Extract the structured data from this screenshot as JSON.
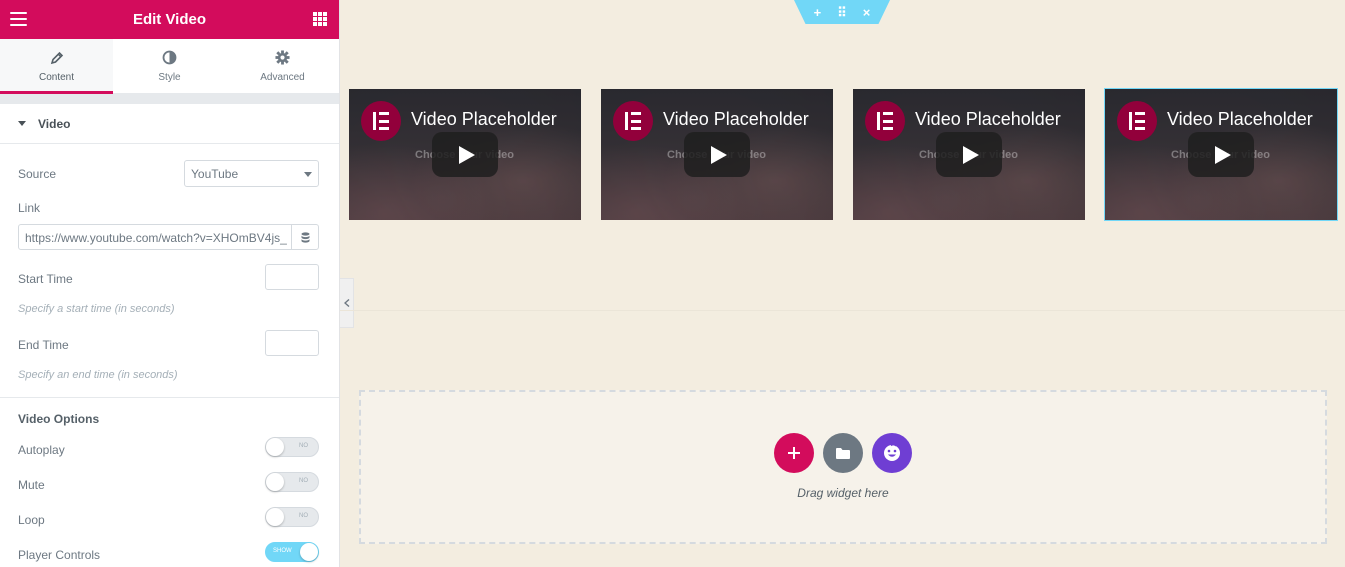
{
  "panel": {
    "title": "Edit Video",
    "tabs": [
      {
        "label": "Content",
        "icon": "pencil-icon",
        "active": true
      },
      {
        "label": "Style",
        "icon": "contrast-icon",
        "active": false
      },
      {
        "label": "Advanced",
        "icon": "gear-icon",
        "active": false
      }
    ],
    "section_title": "Video",
    "source": {
      "label": "Source",
      "value": "YouTube"
    },
    "link": {
      "label": "Link",
      "value": "https://www.youtube.com/watch?v=XHOmBV4js_"
    },
    "start_time": {
      "label": "Start Time",
      "hint": "Specify a start time (in seconds)"
    },
    "end_time": {
      "label": "End Time",
      "hint": "Specify an end time (in seconds)"
    },
    "video_options": {
      "title": "Video Options",
      "autoplay": {
        "label": "Autoplay",
        "state": "NO"
      },
      "mute": {
        "label": "Mute",
        "state": "NO"
      },
      "loop": {
        "label": "Loop",
        "state": "NO"
      },
      "player_controls": {
        "label": "Player Controls",
        "state": "SHOW"
      }
    }
  },
  "section_handle": {
    "add": "+",
    "drag": "⠿",
    "close": "×"
  },
  "videos": [
    {
      "title": "Video Placeholder",
      "overlay": "Choose your video"
    },
    {
      "title": "Video Placeholder",
      "overlay": "Choose your video"
    },
    {
      "title": "Video Placeholder",
      "overlay": "Choose your video"
    },
    {
      "title": "Video Placeholder",
      "overlay": "Choose your video"
    }
  ],
  "dropzone": {
    "text": "Drag widget here"
  },
  "colors": {
    "brand": "#d30c5c",
    "accent": "#71d7f7",
    "canvas": "#f3ede0"
  }
}
